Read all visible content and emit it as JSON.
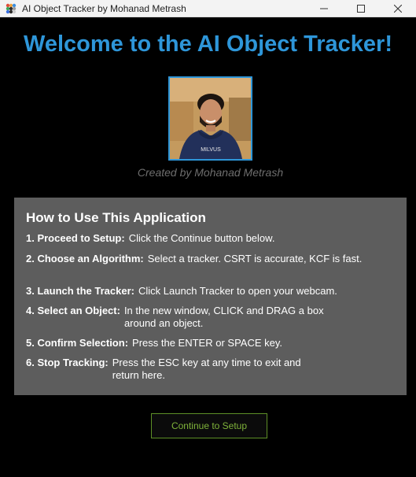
{
  "window": {
    "title": "AI Object Tracker by Mohanad Metrash",
    "app_icon": "palette-app-icon",
    "controls": [
      "minimize-icon",
      "maximize-icon",
      "close-icon"
    ]
  },
  "main": {
    "welcome": "Welcome to the AI Object Tracker!",
    "created_by": "Created by Mohanad Metrash",
    "accent_color": "#2e96d9"
  },
  "instructions": {
    "title": "How to Use This Application",
    "steps": [
      {
        "label": "1. Proceed to Setup:",
        "desc": "Click the Continue button below."
      },
      {
        "label": "2. Choose an Algorithm:",
        "desc": "Select a tracker. CSRT is accurate, KCF is fast."
      },
      {
        "label": "3. Launch the Tracker:",
        "desc": "Click Launch Tracker to open your webcam."
      },
      {
        "label": "4. Select an Object:",
        "desc": "In the new window, CLICK and DRAG a box around an object."
      },
      {
        "label": "5. Confirm Selection:",
        "desc": "Press the ENTER or SPACE key."
      },
      {
        "label": "6. Stop Tracking:",
        "desc": "Press the ESC key at any time to exit and return here."
      }
    ]
  },
  "continue_button": {
    "label": "Continue to Setup",
    "color": "#7fb33a"
  }
}
